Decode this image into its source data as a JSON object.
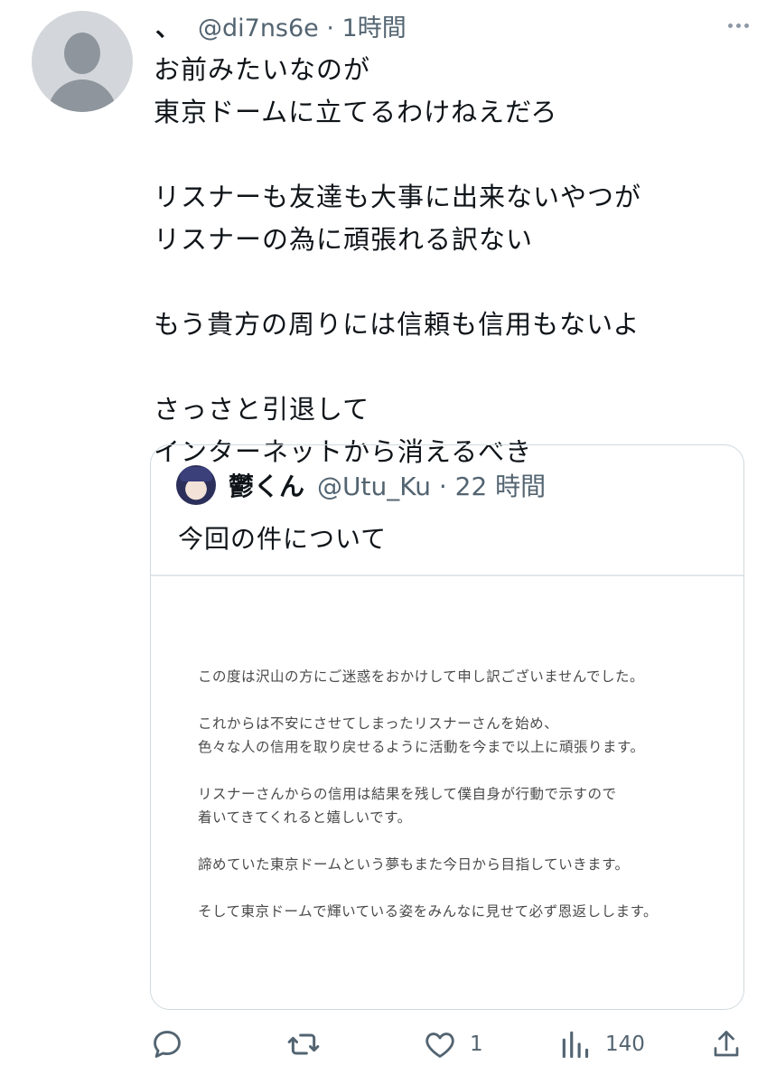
{
  "tweet": {
    "author_name": "、",
    "meta": "@di7ns6e · 1時間",
    "text_paragraphs": [
      [
        "お前みたいなのが",
        "東京ドームに立てるわけねえだろ"
      ],
      [
        "リスナーも友達も大事に出来ないやつが",
        "リスナーの為に頑張れる訳ない"
      ],
      [
        "もう貴方の周りには信頼も信用もないよ"
      ],
      [
        "さっさと引退して",
        "インターネットから消えるべき"
      ]
    ]
  },
  "quote": {
    "author_name": "鬱くん",
    "meta": "@Utu_Ku · 22 時間",
    "text": "今回の件について",
    "image_text_paragraphs": [
      [
        "この度は沢山の方にご迷惑をおかけして申し訳ございませんでした。"
      ],
      [
        "これからは不安にさせてしまったリスナーさんを始め、",
        "色々な人の信用を取り戻せるように活動を今まで以上に頑張ります。"
      ],
      [
        "リスナーさんからの信用は結果を残して僕自身が行動で示すので",
        "着いてきてくれると嬉しいです。"
      ],
      [
        "諦めていた東京ドームという夢もまた今日から目指していきます。"
      ],
      [
        "そして東京ドームで輝いている姿をみんなに見せて必ず恩返しします。"
      ]
    ]
  },
  "actions": {
    "reply_icon": "reply-icon",
    "retweet_icon": "retweet-icon",
    "like_icon": "heart-icon",
    "like_count": "1",
    "views_icon": "views-icon",
    "views_count": "140",
    "share_icon": "share-icon"
  },
  "colors": {
    "text_primary": "#0f1419",
    "text_secondary": "#536471",
    "border": "#cfd9de"
  }
}
